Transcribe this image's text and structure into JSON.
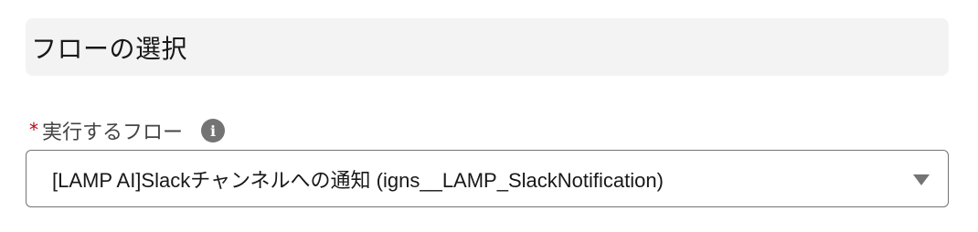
{
  "section": {
    "title": "フローの選択"
  },
  "field": {
    "required_mark": "*",
    "label": "実行するフロー",
    "help_icon": "info-icon",
    "help_glyph": "i",
    "selected_value": "[LAMP AI]Slackチャンネルへの通知 (igns__LAMP_SlackNotification)",
    "dropdown_icon": "chevron-down-icon"
  },
  "colors": {
    "required": "#ba0517",
    "header_bg": "#f3f3f3",
    "border": "#747474",
    "icon": "#747474"
  }
}
